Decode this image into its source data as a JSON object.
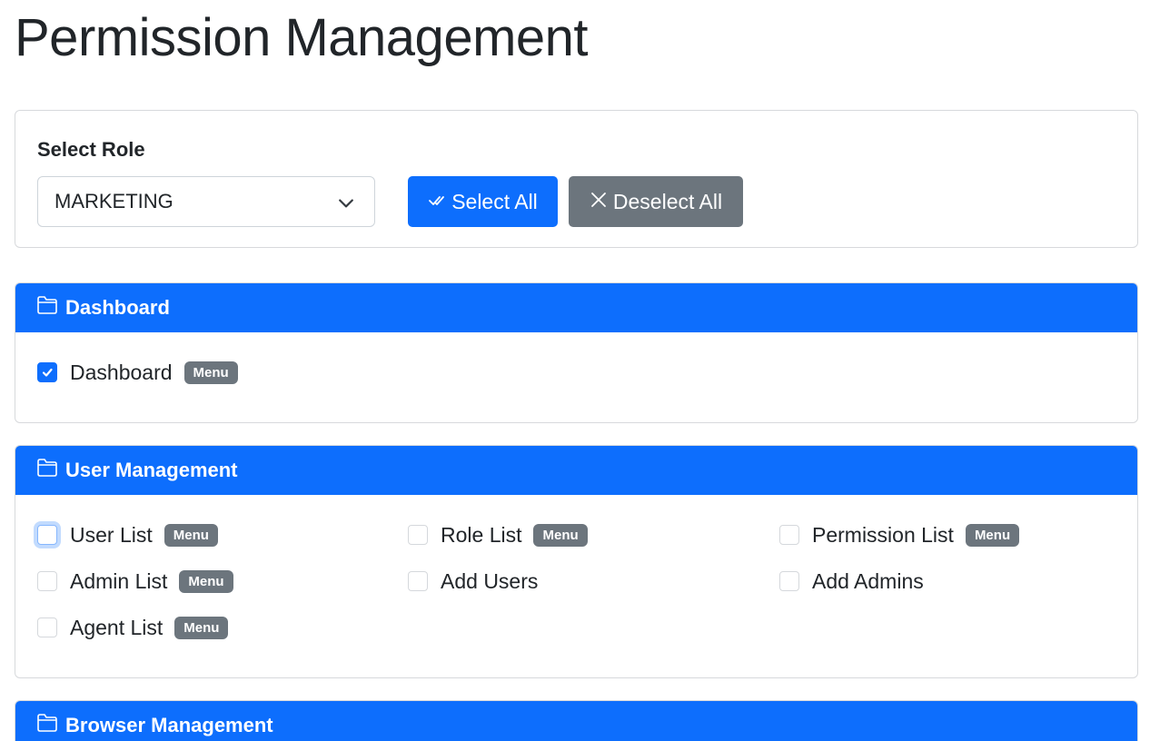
{
  "page": {
    "title": "Permission Management"
  },
  "role_card": {
    "label": "Select Role",
    "selected_role": "MARKETING",
    "select_all_label": "Select All",
    "deselect_all_label": "Deselect All"
  },
  "colors": {
    "primary": "#0d6efd",
    "secondary": "#6c757d",
    "border": "#d7d9dc"
  },
  "sections": [
    {
      "title": "Dashboard",
      "icon": "folder-icon",
      "permissions": [
        {
          "label": "Dashboard",
          "badge": "Menu",
          "checked": true
        }
      ]
    },
    {
      "title": "User Management",
      "icon": "folder-icon",
      "permissions": [
        {
          "label": "User List",
          "badge": "Menu",
          "checked": false,
          "focused": true
        },
        {
          "label": "Role List",
          "badge": "Menu",
          "checked": false
        },
        {
          "label": "Permission List",
          "badge": "Menu",
          "checked": false
        },
        {
          "label": "Admin List",
          "badge": "Menu",
          "checked": false
        },
        {
          "label": "Add Users",
          "badge": "",
          "checked": false
        },
        {
          "label": "Add Admins",
          "badge": "",
          "checked": false
        },
        {
          "label": "Agent List",
          "badge": "Menu",
          "checked": false
        }
      ]
    },
    {
      "title": "Browser Management",
      "icon": "folder-icon",
      "permissions": []
    }
  ]
}
